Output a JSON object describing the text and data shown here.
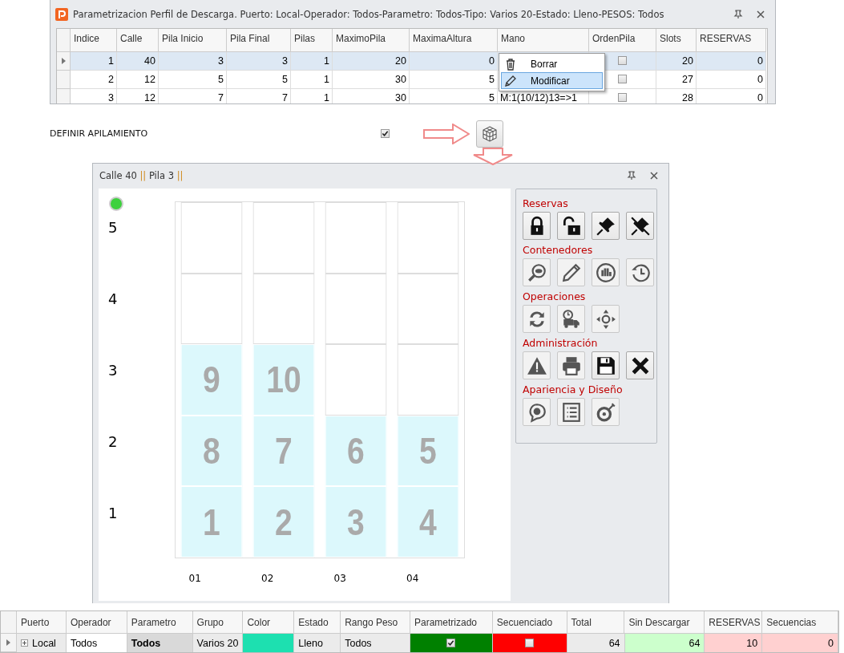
{
  "top_window": {
    "title": "Parametrizacion Perfil de Descarga. Puerto: Local-Operador: Todos-Parametro: Todos-Tipo: Varios 20-Estado: Lleno-PESOS: Todos",
    "table": {
      "columns": [
        "Indice",
        "Calle",
        "Pila Inicio",
        "Pila Final",
        "Pilas",
        "MaximoPila",
        "MaximaAltura",
        "Mano",
        "OrdenPila",
        "Slots",
        "RESERVAS"
      ],
      "rows": [
        {
          "selected": true,
          "values": [
            "1",
            "40",
            "3",
            "3",
            "1",
            "20",
            "0"
          ],
          "orden_pila": false,
          "slots": "20",
          "reservas": "0"
        },
        {
          "selected": false,
          "values": [
            "2",
            "12",
            "5",
            "5",
            "1",
            "30",
            "5"
          ],
          "orden_pila": false,
          "slots": "27",
          "reservas": "0"
        },
        {
          "selected": false,
          "values": [
            "3",
            "12",
            "7",
            "7",
            "1",
            "30",
            "5"
          ],
          "mano": "M:1(10/12)13=>1",
          "orden_pila": false,
          "slots": "28",
          "reservas": "0"
        }
      ]
    },
    "context_menu": {
      "items": [
        {
          "label": "Borrar",
          "selected": false
        },
        {
          "label": "Modificar",
          "selected": true
        }
      ]
    }
  },
  "define_stacking": {
    "label": "DEFINIR APILAMIENTO",
    "checked": true
  },
  "stack_window": {
    "title_segments": [
      "Calle 40",
      "||",
      "Pila 3",
      "||"
    ],
    "grid": {
      "rows": [
        {
          "label": "5",
          "cells": [
            {
              "filled": false
            },
            {
              "filled": false
            },
            {
              "filled": false
            },
            {
              "filled": false
            }
          ]
        },
        {
          "label": "4",
          "cells": [
            {
              "filled": false
            },
            {
              "filled": false
            },
            {
              "filled": false
            },
            {
              "filled": false
            }
          ]
        },
        {
          "label": "3",
          "cells": [
            {
              "filled": true,
              "number": "9"
            },
            {
              "filled": true,
              "number": "10"
            },
            {
              "filled": false
            },
            {
              "filled": false
            }
          ]
        },
        {
          "label": "2",
          "cells": [
            {
              "filled": true,
              "number": "8"
            },
            {
              "filled": true,
              "number": "7"
            },
            {
              "filled": true,
              "number": "6"
            },
            {
              "filled": true,
              "number": "5"
            }
          ]
        },
        {
          "label": "1",
          "cells": [
            {
              "filled": true,
              "number": "1"
            },
            {
              "filled": true,
              "number": "2"
            },
            {
              "filled": true,
              "number": "3"
            },
            {
              "filled": true,
              "number": "4"
            }
          ]
        }
      ],
      "x_labels": [
        "01",
        "02",
        "03",
        "04"
      ]
    },
    "tool_panel": {
      "sections": [
        {
          "title": "Reservas",
          "buttons": [
            {
              "disabled": false
            },
            {
              "disabled": false
            },
            {
              "disabled": false
            },
            {
              "disabled": false
            }
          ]
        },
        {
          "title": "Contenedores",
          "buttons": [
            {
              "disabled": true
            },
            {
              "disabled": true
            },
            {
              "disabled": true
            },
            {
              "disabled": true
            }
          ]
        },
        {
          "title": "Operaciones",
          "buttons": [
            {
              "disabled": true
            },
            {
              "disabled": true
            },
            {
              "disabled": true
            }
          ]
        },
        {
          "title": "Administración",
          "buttons": [
            {
              "disabled": true
            },
            {
              "disabled": true
            },
            {
              "disabled": false
            },
            {
              "disabled": false
            }
          ]
        },
        {
          "title": "Apariencia y Diseño",
          "buttons": [
            {
              "disabled": true
            },
            {
              "disabled": true
            },
            {
              "disabled": true
            }
          ]
        }
      ]
    }
  },
  "bottom_table": {
    "columns": [
      "Puerto",
      "Operador",
      "Parametro",
      "Grupo",
      "Color",
      "Estado",
      "Rango Peso",
      "Parametrizado",
      "Secuenciado",
      "Total",
      "Sin Descargar",
      "RESERVAS",
      "Secuencias"
    ],
    "row": {
      "selected": true,
      "expanded": false,
      "cells": [
        {
          "kind": "text",
          "text": "Local"
        },
        {
          "kind": "text",
          "text": "Todos",
          "color": "#ffffff"
        },
        {
          "kind": "text",
          "text": "Todos",
          "bold": true,
          "color": "#d9d9d9"
        },
        {
          "kind": "text",
          "text": "Varios 20"
        },
        {
          "kind": "swatch",
          "color": "#1de0b0"
        },
        {
          "kind": "text",
          "text": "Lleno"
        },
        {
          "kind": "text",
          "text": "Todos"
        },
        {
          "kind": "check",
          "checked": true,
          "color": "#008000"
        },
        {
          "kind": "check",
          "checked": false,
          "color": "#ff0000"
        },
        {
          "kind": "number",
          "text": "64"
        },
        {
          "kind": "number",
          "text": "64",
          "color": "#ccffcc"
        },
        {
          "kind": "number",
          "text": "10",
          "color": "#ffd0d0"
        },
        {
          "kind": "number",
          "text": "0",
          "color": "#ffd0d0"
        }
      ]
    }
  }
}
